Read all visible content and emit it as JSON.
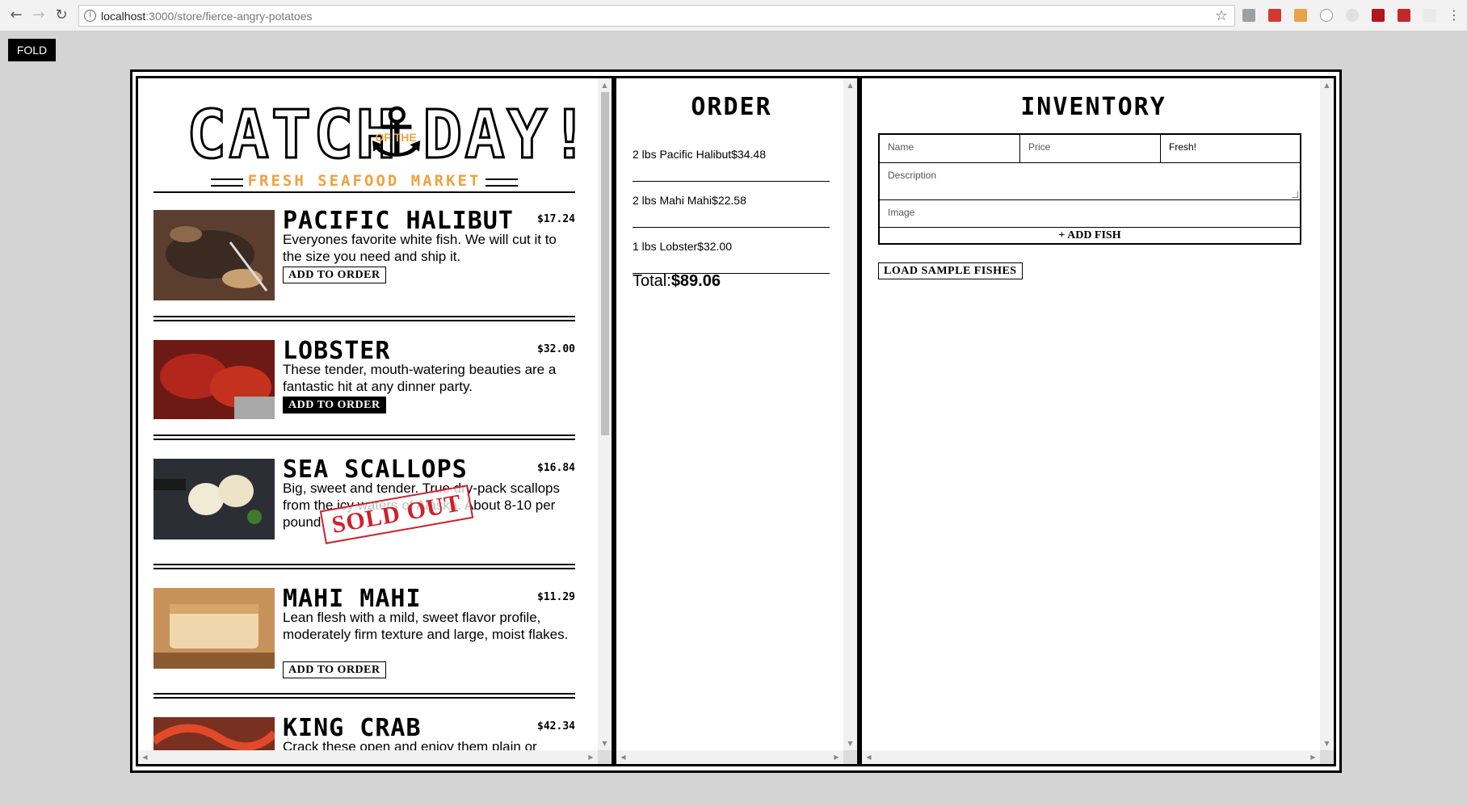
{
  "browser": {
    "url_host": "localhost",
    "url_path": ":3000/store/fierce-angry-potatoes"
  },
  "fold_label": "FOLD",
  "logo": {
    "catch": "CATCH",
    "of_the": "OF THE",
    "day": "DAY!",
    "subtitle": "FRESH SEAFOOD MARKET"
  },
  "fishes": [
    {
      "name": "PACIFIC HALIBUT",
      "price": "$17.24",
      "desc": "Everyones favorite white fish. We will cut it to the size you need and ship it.",
      "button": "ADD TO ORDER",
      "photo_color": "#6b4a36"
    },
    {
      "name": "LOBSTER",
      "price": "$32.00",
      "desc": "These tender, mouth-watering beauties are a fantastic hit at any dinner party.",
      "button": "ADD TO ORDER",
      "photo_color": "#a3261c"
    },
    {
      "name": "SEA SCALLOPS",
      "price": "$16.84",
      "desc": "Big, sweet and tender. True dry-pack scallops from the icy waters of Alaska. About 8-10 per pound",
      "sold_out": "SOLD OUT",
      "photo_color": "#2e3138"
    },
    {
      "name": "MAHI MAHI",
      "price": "$11.29",
      "desc": "Lean flesh with a mild, sweet flavor profile, moderately firm texture and large, moist flakes.",
      "button": "ADD TO ORDER",
      "photo_color": "#c99b6a"
    },
    {
      "name": "KING CRAB",
      "price": "$42.34",
      "desc": "Crack these open and enjoy them plain or",
      "photo_color": "#b23a25"
    }
  ],
  "order": {
    "title": "ORDER",
    "lines": [
      "2 lbs Pacific Halibut$34.48",
      "2 lbs Mahi Mahi$22.58",
      "1 lbs Lobster$32.00"
    ],
    "total_label": "Total:",
    "total_value": "$89.06"
  },
  "inventory": {
    "title": "INVENTORY",
    "name_placeholder": "Name",
    "price_placeholder": "Price",
    "status_value": "Fresh!",
    "desc_placeholder": "Description",
    "image_placeholder": "Image",
    "add_fish_label": "+ ADD FISH",
    "load_samples_label": "LOAD SAMPLE FISHES"
  }
}
